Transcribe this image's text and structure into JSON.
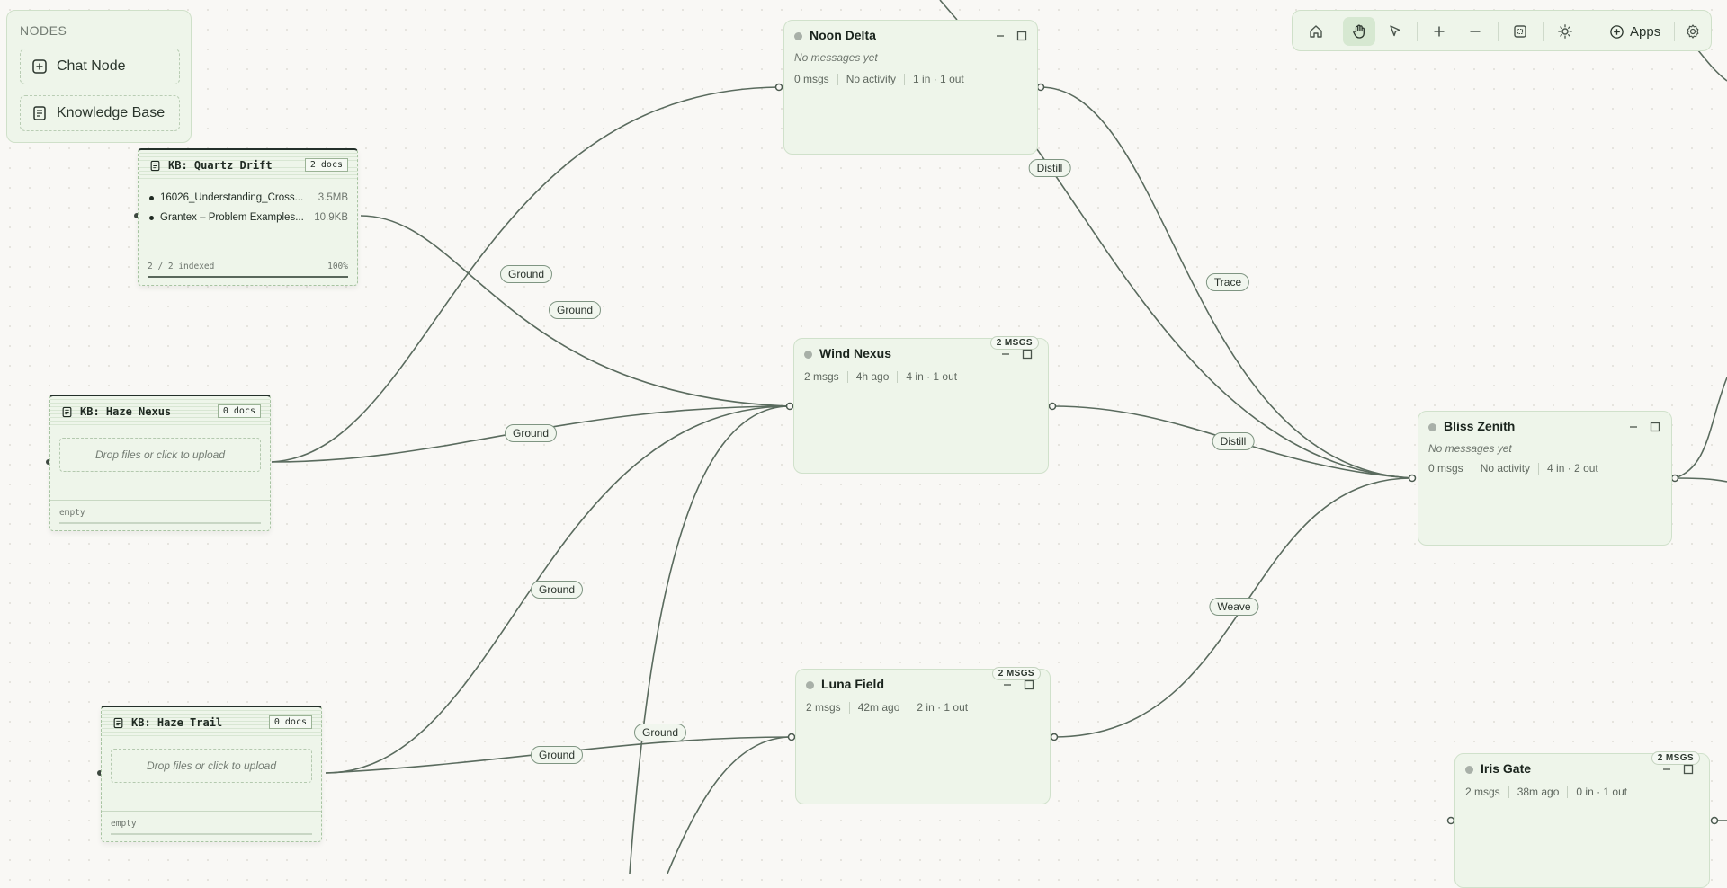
{
  "palette": {
    "title": "NODES",
    "items": [
      {
        "label": "Chat Node",
        "icon": "plus-square-icon"
      },
      {
        "label": "Knowledge Base",
        "icon": "document-icon"
      }
    ]
  },
  "toolbar": {
    "buttons": [
      "home-icon",
      "hand-pan-icon",
      "pointer-select-icon",
      "zoom-in-icon",
      "zoom-out-icon",
      "fit-view-icon",
      "theme-sun-icon"
    ],
    "active": "hand-pan-icon",
    "apps_label": "Apps"
  },
  "kb_nodes": {
    "quartz": {
      "title": "KB: Quartz Drift",
      "badge": "2 docs",
      "files": [
        {
          "name": "16026_Understanding_Cross...",
          "size": "3.5MB"
        },
        {
          "name": "Grantex – Problem Examples...",
          "size": "10.9KB"
        }
      ],
      "status": "2 / 2 indexed",
      "percent_text": "100%",
      "progress": 1.0
    },
    "haze_nexus": {
      "title": "KB: Haze Nexus",
      "badge": "0 docs",
      "drop": "Drop files or click to upload",
      "status": "empty"
    },
    "haze_trail": {
      "title": "KB: Haze Trail",
      "badge": "0 docs",
      "drop": "Drop files or click to upload",
      "status": "empty"
    }
  },
  "chat_nodes": {
    "noon_delta": {
      "title": "Noon Delta",
      "subtitle": "No messages yet",
      "msgs": "0 msgs",
      "activity": "No activity",
      "io": "1 in · 1 out"
    },
    "wind_nexus": {
      "title": "Wind Nexus",
      "badge": "2 MSGS",
      "msgs": "2 msgs",
      "activity": "4h ago",
      "io": "4 in · 1 out"
    },
    "luna_field": {
      "title": "Luna Field",
      "badge": "2 MSGS",
      "msgs": "2 msgs",
      "activity": "42m ago",
      "io": "2 in · 1 out"
    },
    "bliss_zenith": {
      "title": "Bliss Zenith",
      "subtitle": "No messages yet",
      "msgs": "0 msgs",
      "activity": "No activity",
      "io": "4 in · 2 out"
    },
    "iris_gate": {
      "title": "Iris Gate",
      "badge": "2 MSGS",
      "msgs": "2 msgs",
      "activity": "38m ago",
      "io": "0 in · 1 out"
    }
  },
  "edge_labels": {
    "ground_1": "Ground",
    "ground_2": "Ground",
    "ground_3": "Ground",
    "ground_4": "Ground",
    "ground_5": "Ground",
    "ground_6": "Ground",
    "distill_1": "Distill",
    "distill_2": "Distill",
    "trace": "Trace",
    "weave": "Weave"
  }
}
